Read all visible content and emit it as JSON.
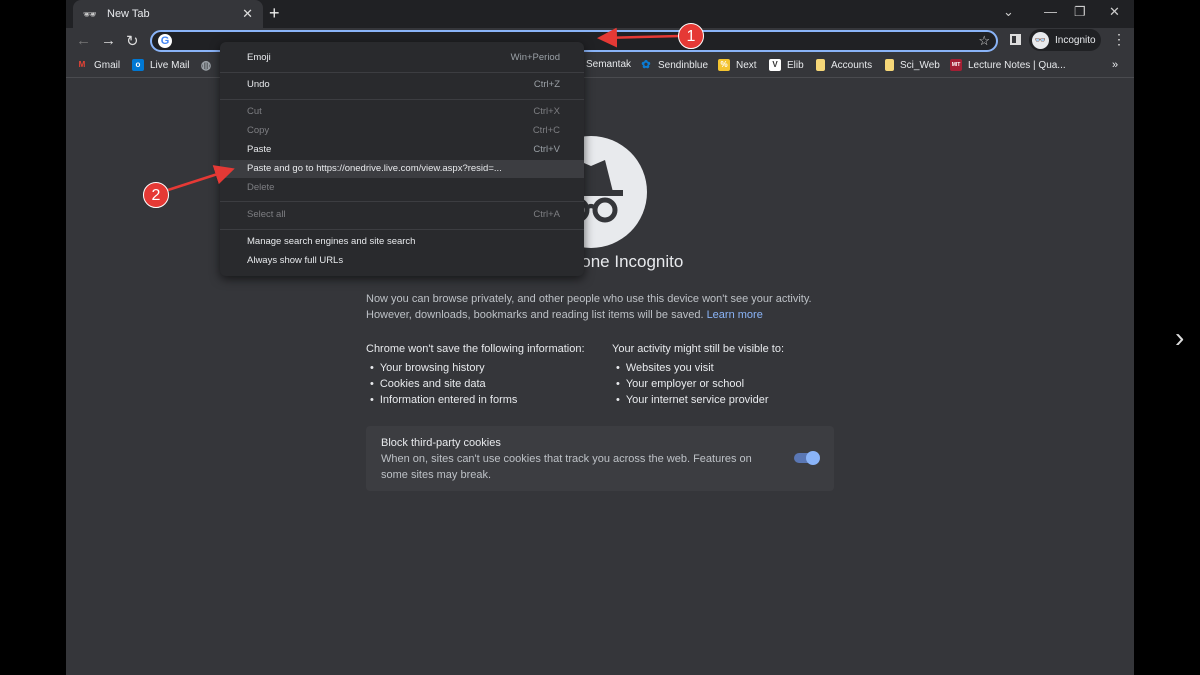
{
  "tab": {
    "title": "New Tab",
    "icon": "incognito-icon"
  },
  "toolbar": {
    "profile_label": "Incognito",
    "google_icon": "G"
  },
  "bookmarks": [
    {
      "label": "Gmail",
      "color": "#ea4335",
      "glyph": "M"
    },
    {
      "label": "Live Mail",
      "color": "#0078d4",
      "glyph": "o"
    },
    {
      "label": "",
      "color": "#9aa0a6",
      "glyph": "◍"
    },
    {
      "label": "Semantak",
      "color": "",
      "glyph": ""
    },
    {
      "label": "Sendinblue",
      "color": "#0b7bd3",
      "glyph": "✿"
    },
    {
      "label": "Next",
      "color": "#f4c430",
      "glyph": "%"
    },
    {
      "label": "Elib",
      "color": "#ffffff",
      "glyph": "V"
    },
    {
      "label": "Accounts",
      "color": "#f6d778",
      "glyph": ""
    },
    {
      "label": "Sci_Web",
      "color": "#f6d778",
      "glyph": ""
    },
    {
      "label": "Lecture Notes | Qua...",
      "color": "#a31f34",
      "glyph": "MIT"
    }
  ],
  "context_menu": [
    {
      "label": "Emoji",
      "shortcut": "Win+Period",
      "enabled": true
    },
    {
      "label": "Undo",
      "shortcut": "Ctrl+Z",
      "enabled": true
    },
    {
      "label": "Cut",
      "shortcut": "Ctrl+X",
      "enabled": false
    },
    {
      "label": "Copy",
      "shortcut": "Ctrl+C",
      "enabled": false
    },
    {
      "label": "Paste",
      "shortcut": "Ctrl+V",
      "enabled": true
    },
    {
      "label": "Paste and go to https://onedrive.live.com/view.aspx?resid=...",
      "shortcut": "",
      "enabled": true,
      "highlighted": true
    },
    {
      "label": "Delete",
      "shortcut": "",
      "enabled": false
    },
    {
      "label": "Select all",
      "shortcut": "Ctrl+A",
      "enabled": false
    },
    {
      "label": "Manage search engines and site search",
      "shortcut": "",
      "enabled": true
    },
    {
      "label": "Always show full URLs",
      "shortcut": "",
      "enabled": true
    }
  ],
  "page": {
    "title": "You’ve gone Incognito",
    "intro1": "Now you can browse privately, and other people who use this device won't see your activity.",
    "intro2": "However, downloads, bookmarks and reading list items will be saved.",
    "learn_more": "Learn more",
    "left_heading": "Chrome won't save the following information:",
    "left_items": [
      "Your browsing history",
      "Cookies and site data",
      "Information entered in forms"
    ],
    "right_heading": "Your activity might still be visible to:",
    "right_items": [
      "Websites you visit",
      "Your employer or school",
      "Your internet service provider"
    ],
    "cookies_title": "Block third-party cookies",
    "cookies_desc": "When on, sites can't use cookies that track you across the web. Features on some sites may break.",
    "cookies_toggle_on": true
  },
  "annotations": [
    "1",
    "2"
  ],
  "accent": "#8ab4f8"
}
